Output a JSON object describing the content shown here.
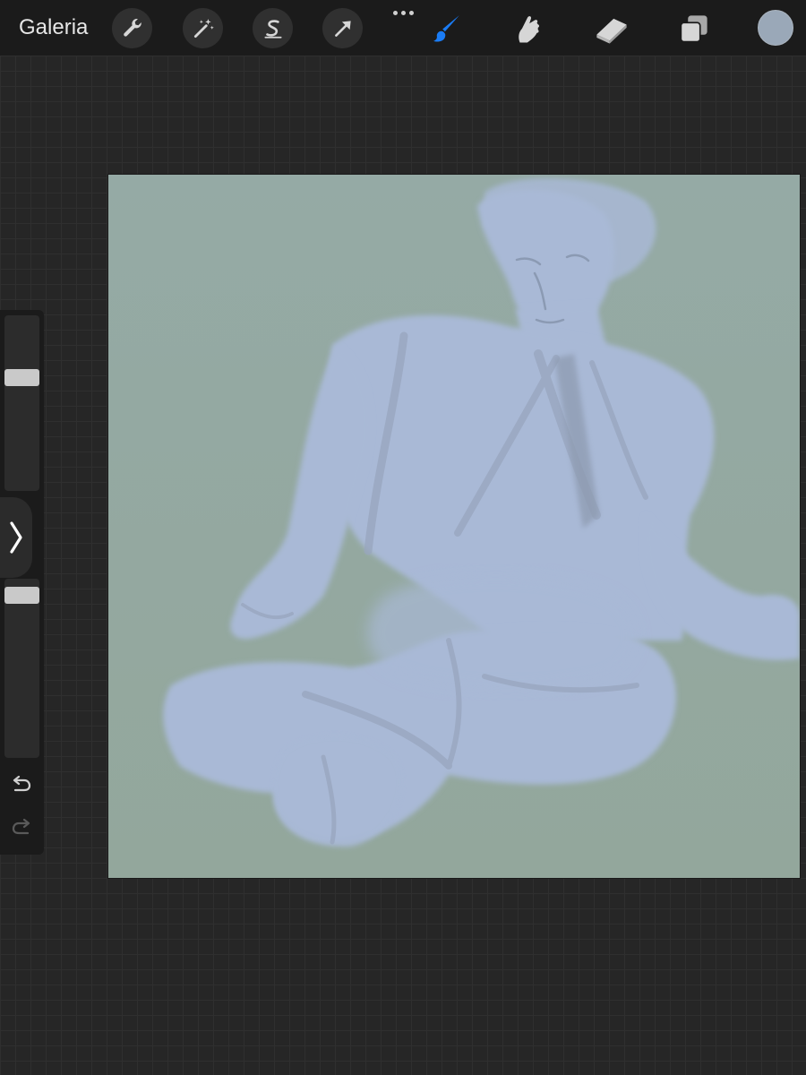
{
  "toolbar": {
    "gallery_label": "Galeria",
    "tools": [
      {
        "name": "actions",
        "icon": "wrench-icon"
      },
      {
        "name": "adjustments",
        "icon": "magic-wand-icon"
      },
      {
        "name": "selection",
        "icon": "selection-s-icon"
      },
      {
        "name": "transform",
        "icon": "arrow-cursor-icon"
      },
      {
        "name": "brush",
        "icon": "brush-icon",
        "active": true
      },
      {
        "name": "smudge",
        "icon": "smudge-finger-icon"
      },
      {
        "name": "eraser",
        "icon": "eraser-icon"
      },
      {
        "name": "layers",
        "icon": "layers-icon"
      }
    ],
    "more_icon": "more-dots-icon",
    "active_color": "#9aa8b8",
    "accent_color": "#1a7cf5"
  },
  "canvas": {
    "background_color": "#93a9a0",
    "subject_color": "#a9b9d6"
  },
  "sidebar": {
    "brush_size_level": 0.66,
    "opacity_level": 0.95,
    "modify_icon": "chevron-right-icon",
    "undo_icon": "undo-icon",
    "redo_icon": "redo-icon"
  }
}
